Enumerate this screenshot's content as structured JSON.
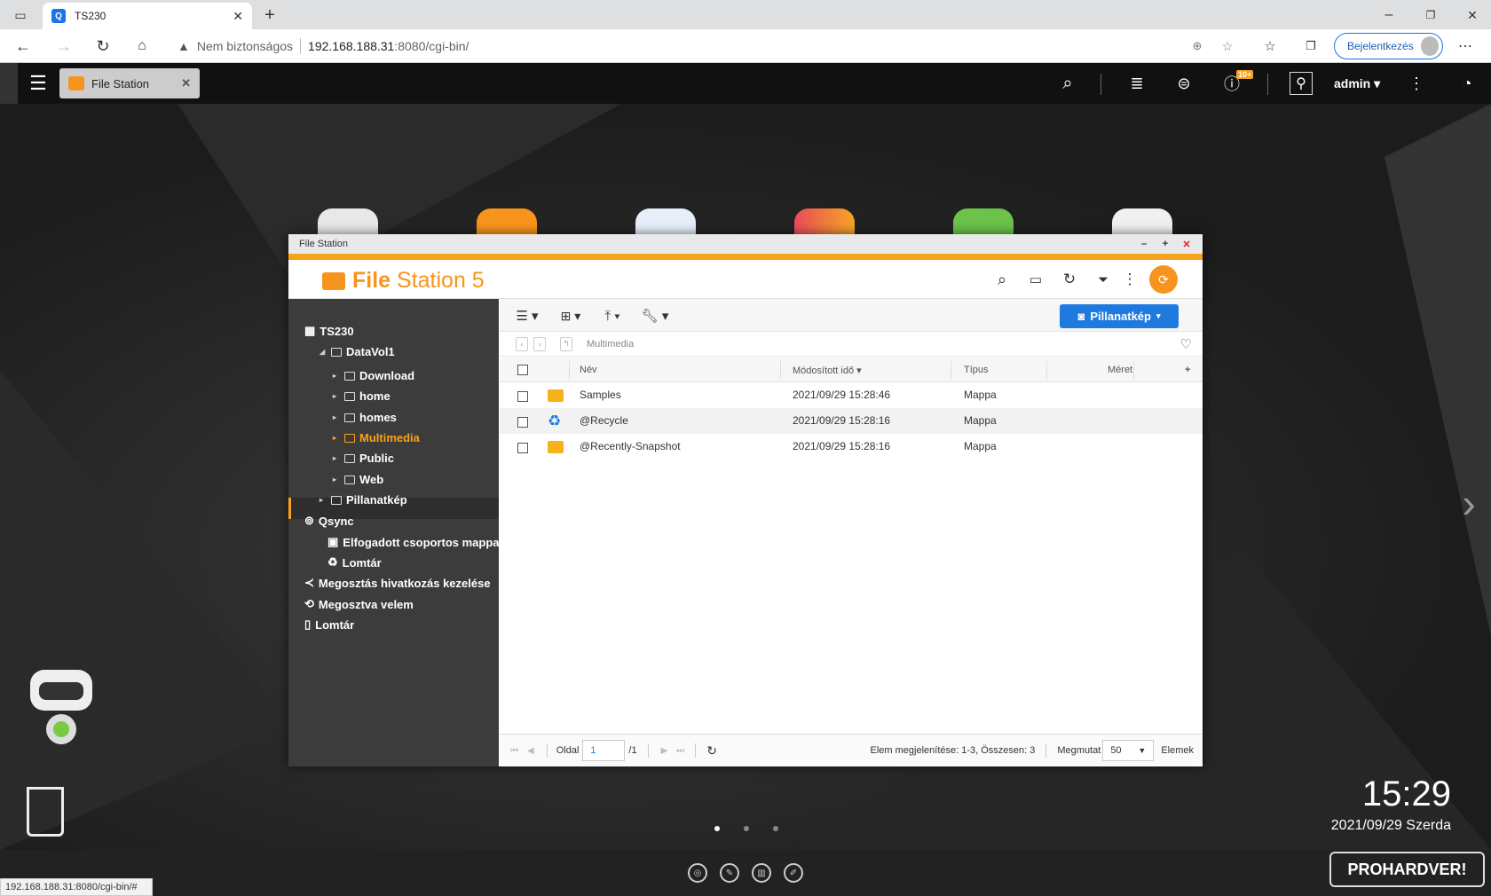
{
  "browser": {
    "tab_title": "TS230",
    "security": "Nem biztonságos",
    "url_host": "192.168.188.31",
    "url_rest": ":8080/cgi-bin/",
    "signin": "Bejelentkezés",
    "status_url": "192.168.188.31:8080/cgi-bin/#"
  },
  "qts": {
    "app_tab": "File Station",
    "user": "admin",
    "notif_badge": "10+"
  },
  "window": {
    "title": "File Station",
    "logo_bold": "File",
    "logo_rest": "Station 5"
  },
  "sidebar": {
    "root": "TS230",
    "volume": "DataVol1",
    "folders": [
      "Download",
      "home",
      "homes",
      "Multimedia",
      "Public",
      "Web"
    ],
    "snapshot": "Pillanatkép",
    "qsync": "Qsync",
    "qsync_items": [
      "Elfogadott csoportos mappa",
      "Lomtár"
    ],
    "share_links": "Megosztás hivatkozás kezelése",
    "shared_with_me": "Megosztva velem",
    "recycle": "Lomtár"
  },
  "toolbar": {
    "snapshot_button": "Pillanatkép"
  },
  "breadcrumb": "Multimedia",
  "table": {
    "headers": {
      "name": "Név",
      "modified": "Módosított idő",
      "type": "Típus",
      "size": "Méret"
    },
    "rows": [
      {
        "name": "Samples",
        "modified": "2021/09/29 15:28:46",
        "type": "Mappa"
      },
      {
        "name": "@Recycle",
        "modified": "2021/09/29 15:28:16",
        "type": "Mappa"
      },
      {
        "name": "@Recently-Snapshot",
        "modified": "2021/09/29 15:28:16",
        "type": "Mappa"
      }
    ]
  },
  "footer": {
    "page_label": "Oldal",
    "page": "1",
    "page_total": "/1",
    "display": "Elem megjelenítése: 1-3, Összesen: 3",
    "show_label": "Megmutat",
    "per_page": "50",
    "items_label": "Elemek"
  },
  "desktop": {
    "time": "15:29",
    "date": "2021/09/29 Szerda",
    "brand": "PROHARDVER!"
  },
  "colors": {
    "accent": "#f7941d",
    "primary": "#1f7ae0"
  }
}
